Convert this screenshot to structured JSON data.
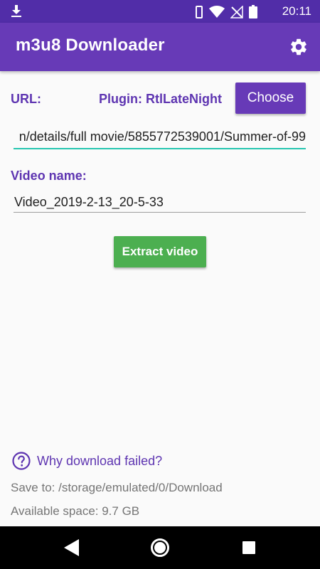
{
  "status_bar": {
    "time": "20:11",
    "icons": [
      "download-icon",
      "vibrate-icon",
      "wifi-icon",
      "no-signal-icon",
      "battery-icon"
    ]
  },
  "app_bar": {
    "title": "m3u8 Downloader",
    "settings_icon": "gear-icon"
  },
  "form": {
    "url_label": "URL:",
    "plugin_label": "Plugin: RtlLateNight",
    "choose_button": "Choose",
    "url_value": "n/details/full movie/5855772539001/Summer-of-99",
    "video_name_label": "Video name:",
    "video_name_value": "Video_2019-2-13_20-5-33",
    "extract_button": "Extract video"
  },
  "footer": {
    "help_text": "Why download failed?",
    "help_icon": "question-circle-icon",
    "save_to": "Save to: /storage/emulated/0/Download",
    "available_space": "Available space: 9.7 GB"
  },
  "nav_bar": {
    "buttons": [
      "back-icon",
      "home-icon",
      "recents-icon"
    ]
  },
  "colors": {
    "primary": "#673ab7",
    "primary_dark": "#512da8",
    "accent_teal": "#26c6b0",
    "extract_green": "#4caf50"
  }
}
